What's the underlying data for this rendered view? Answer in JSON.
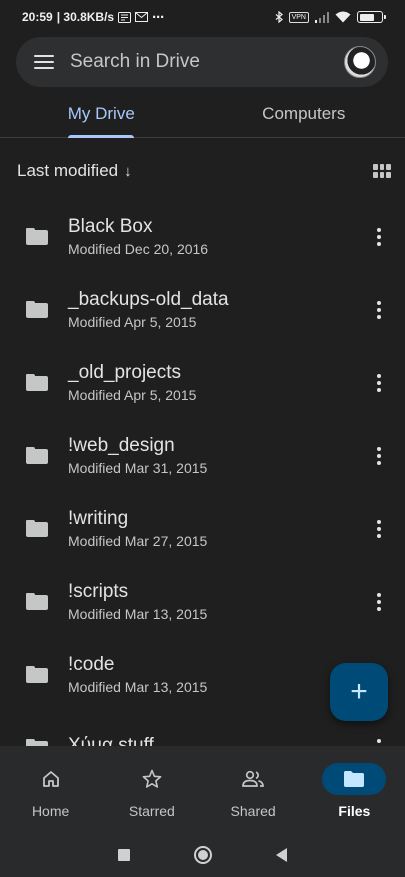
{
  "status_bar": {
    "time": "20:59",
    "network_speed": "| 30.8KB/s",
    "extras": "⋯",
    "vpn": "VPN"
  },
  "search": {
    "placeholder": "Search in Drive"
  },
  "tabs": [
    {
      "label": "My Drive",
      "active": true
    },
    {
      "label": "Computers",
      "active": false
    }
  ],
  "sort": {
    "label": "Last modified",
    "direction_icon": "arrow-down"
  },
  "files": [
    {
      "name": "Black Box",
      "meta": "Modified Dec 20, 2016"
    },
    {
      "name": "_backups-old_data",
      "meta": "Modified Apr 5, 2015"
    },
    {
      "name": "_old_projects",
      "meta": "Modified Apr 5, 2015"
    },
    {
      "name": "!web_design",
      "meta": "Modified Mar 31, 2015"
    },
    {
      "name": "!writing",
      "meta": "Modified Mar 27, 2015"
    },
    {
      "name": "!scripts",
      "meta": "Modified Mar 13, 2015"
    },
    {
      "name": "!code",
      "meta": "Modified Mar 13, 2015"
    },
    {
      "name": "Χύμα stuff",
      "meta": ""
    }
  ],
  "fab": {
    "label": "+"
  },
  "bottom_nav": [
    {
      "label": "Home",
      "icon": "home-icon",
      "active": false
    },
    {
      "label": "Starred",
      "icon": "star-icon",
      "active": false
    },
    {
      "label": "Shared",
      "icon": "shared-icon",
      "active": false
    },
    {
      "label": "Files",
      "icon": "folder-icon",
      "active": true
    }
  ],
  "colors": {
    "background": "#1f1f1f",
    "accent": "#a8c7fa",
    "fab": "#004a77"
  }
}
